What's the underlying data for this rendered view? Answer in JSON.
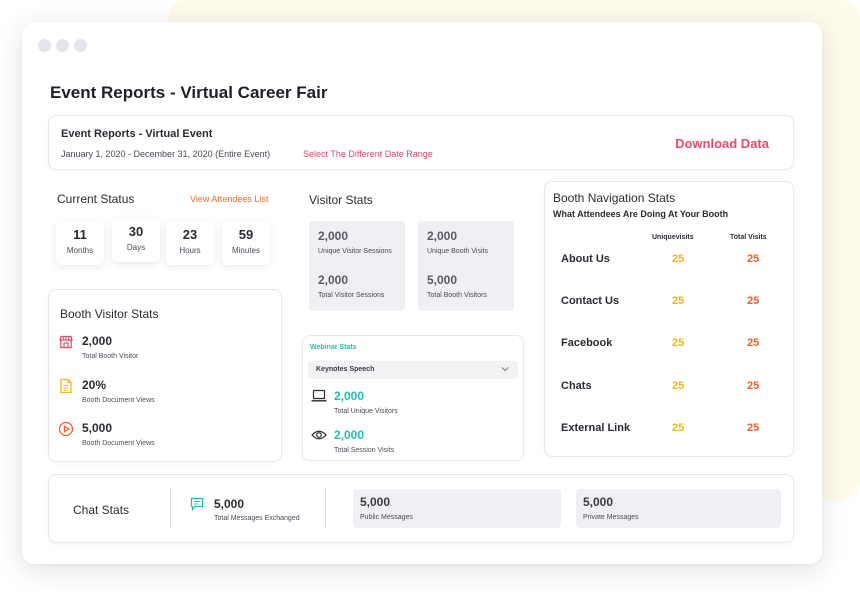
{
  "page_title": "Event Reports - Virtual Career Fair",
  "header": {
    "event_name": "Event Reports - Virtual Event",
    "date_range": "January 1, 2020 - December 31, 2020 (Entire Event)",
    "date_link": "Select The Different Date Range",
    "download_label": "Download Data"
  },
  "current_status": {
    "title": "Current Status",
    "link": "View Attendees List",
    "tiles": [
      {
        "value": "11",
        "label": "Months"
      },
      {
        "value": "30",
        "label": "Days"
      },
      {
        "value": "23",
        "label": "Hours"
      },
      {
        "value": "59",
        "label": "Minutes"
      }
    ]
  },
  "booth_visitor_stats": {
    "title": "Booth Visitor Stats",
    "items": [
      {
        "value": "2,000",
        "label": "Total Booth Visitor",
        "icon": "storefront-icon"
      },
      {
        "value": "20%",
        "label": "Booth Document Views",
        "icon": "document-icon"
      },
      {
        "value": "5,000",
        "label": "Booth Document Views",
        "icon": "play-circle-icon"
      }
    ]
  },
  "visitor_stats": {
    "title": "Visitor Stats",
    "items": [
      {
        "value": "2,000",
        "label": "Unique Visitor Sessions"
      },
      {
        "value": "2,000",
        "label": "Unique Booth Visits"
      },
      {
        "value": "2,000",
        "label": "Total Visitor Sessions"
      },
      {
        "value": "5,000",
        "label": "Total Booth Visitors"
      }
    ]
  },
  "webinar_stats": {
    "title": "Webinar Stats",
    "selected": "Keynotes Speech",
    "items": [
      {
        "value": "2,000",
        "label": "Total Unique Visitors",
        "icon": "laptop-icon"
      },
      {
        "value": "2,000",
        "label": "Total Session Visits",
        "icon": "eye-icon"
      }
    ]
  },
  "booth_navigation": {
    "title": "Booth Navigation Stats",
    "subtitle": "What Attendees Are Doing At Your Booth",
    "col_unique": "Uniquevisits",
    "col_total": "Total Visits",
    "rows": [
      {
        "name": "About Us",
        "unique": "25",
        "total": "25"
      },
      {
        "name": "Contact Us",
        "unique": "25",
        "total": "25"
      },
      {
        "name": "Facebook",
        "unique": "25",
        "total": "25"
      },
      {
        "name": "Chats",
        "unique": "25",
        "total": "25"
      },
      {
        "name": "External Link",
        "unique": "25",
        "total": "25"
      }
    ]
  },
  "chat_stats": {
    "title": "Chat Stats",
    "messages_value": "5,000",
    "messages_label": "Total Messages Exchanged",
    "public_value": "5,000",
    "public_label": "Public Messages",
    "private_value": "5,000",
    "private_label": "Private Messages"
  },
  "colors": {
    "accent_pink": "#ec4a6f",
    "accent_orange": "#ef6c2f",
    "accent_teal": "#1cc3b2",
    "accent_yellow": "#f2b511"
  }
}
